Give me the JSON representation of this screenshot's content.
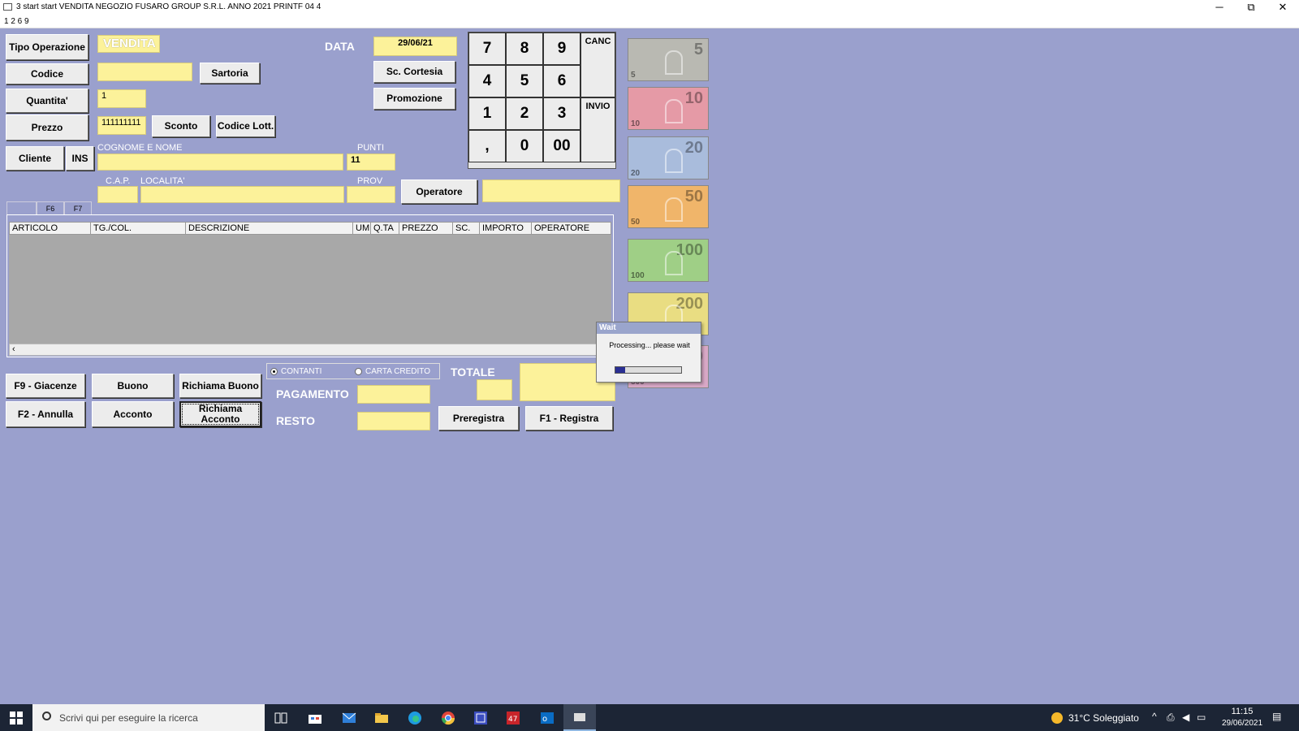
{
  "window": {
    "title": "3 start start VENDITA NEGOZIO FUSARO GROUP S.R.L. ANNO 2021 PRINTF 04 4",
    "menu_text": "1 2 6 9",
    "minimize": "─",
    "restore": "⧉",
    "close": "✕"
  },
  "left_buttons": {
    "tipo_operazione": "Tipo Operazione",
    "codice": "Codice",
    "quantita": "Quantita'",
    "prezzo": "Prezzo",
    "cliente": "Cliente",
    "ins": "INS"
  },
  "fields": {
    "operazione": "VENDITA",
    "codice": "",
    "quantita": "1",
    "prezzo": "111111111",
    "cognome_nome": "",
    "punti": "11",
    "cap": "",
    "localita": "",
    "prov": "",
    "data": "29/06/21",
    "operatore": ""
  },
  "labels": {
    "data": "DATA",
    "cognome_nome": "COGNOME E NOME",
    "punti": "PUNTI",
    "cap": "C.A.P.",
    "localita": "LOCALITA'",
    "prov": "PROV",
    "totale": "TOTALE",
    "pagamento": "PAGAMENTO",
    "resto": "RESTO"
  },
  "mid_buttons": {
    "sartoria": "Sartoria",
    "sconto": "Sconto",
    "codice_lott": "Codice Lott.",
    "sc_cortesia": "Sc. Cortesia",
    "promozione": "Promozione",
    "operatore": "Operatore"
  },
  "keypad": {
    "k7": "7",
    "k8": "8",
    "k9": "9",
    "k4": "4",
    "k5": "5",
    "k6": "6",
    "k1": "1",
    "k2": "2",
    "k3": "3",
    "kcomma": ",",
    "k0": "0",
    "k00": "00",
    "canc": "CANC",
    "invio": "INVIO"
  },
  "tabs": [
    "",
    "F6",
    "F7"
  ],
  "grid": {
    "columns": [
      "ARTICOLO",
      "TG./COL.",
      "DESCRIZIONE",
      "UM",
      "Q.TA",
      "PREZZO",
      "SC.",
      "IMPORTO",
      "OPERATORE"
    ],
    "rows": [],
    "scroll_left": "‹"
  },
  "bottom_buttons": {
    "f9": "F9 - Giacenze",
    "buono": "Buono",
    "richiama_buono": "Richiama Buono",
    "f2": "F2 - Annulla",
    "acconto": "Acconto",
    "richiama_acconto": "Richiama Acconto",
    "preregistra": "Preregistra",
    "f1": "F1 - Registra"
  },
  "payment": {
    "contanti": "CONTANTI",
    "carta_credito": "CARTA CREDITO",
    "selected": "CONTANTI",
    "totale_small": "",
    "totale": "",
    "pagamento": "",
    "resto": ""
  },
  "banknotes": [
    {
      "value": "5",
      "color": "#b9b9b2"
    },
    {
      "value": "10",
      "color": "#e59aa6"
    },
    {
      "value": "20",
      "color": "#a9bcdc"
    },
    {
      "value": "50",
      "color": "#f0b56a"
    },
    {
      "value": "100",
      "color": "#9fcf86"
    },
    {
      "value": "200",
      "color": "#e9dd82"
    },
    {
      "value": "500",
      "color": "#d9a8c6"
    }
  ],
  "wait_dialog": {
    "title": "Wait",
    "message": "Processing... please wait",
    "progress": 0.15
  },
  "taskbar": {
    "search_placeholder": "Scrivi qui per eseguire la ricerca",
    "weather": "31°C  Soleggiato",
    "time": "11:15",
    "date": "29/06/2021",
    "accent": "#1c2535"
  }
}
